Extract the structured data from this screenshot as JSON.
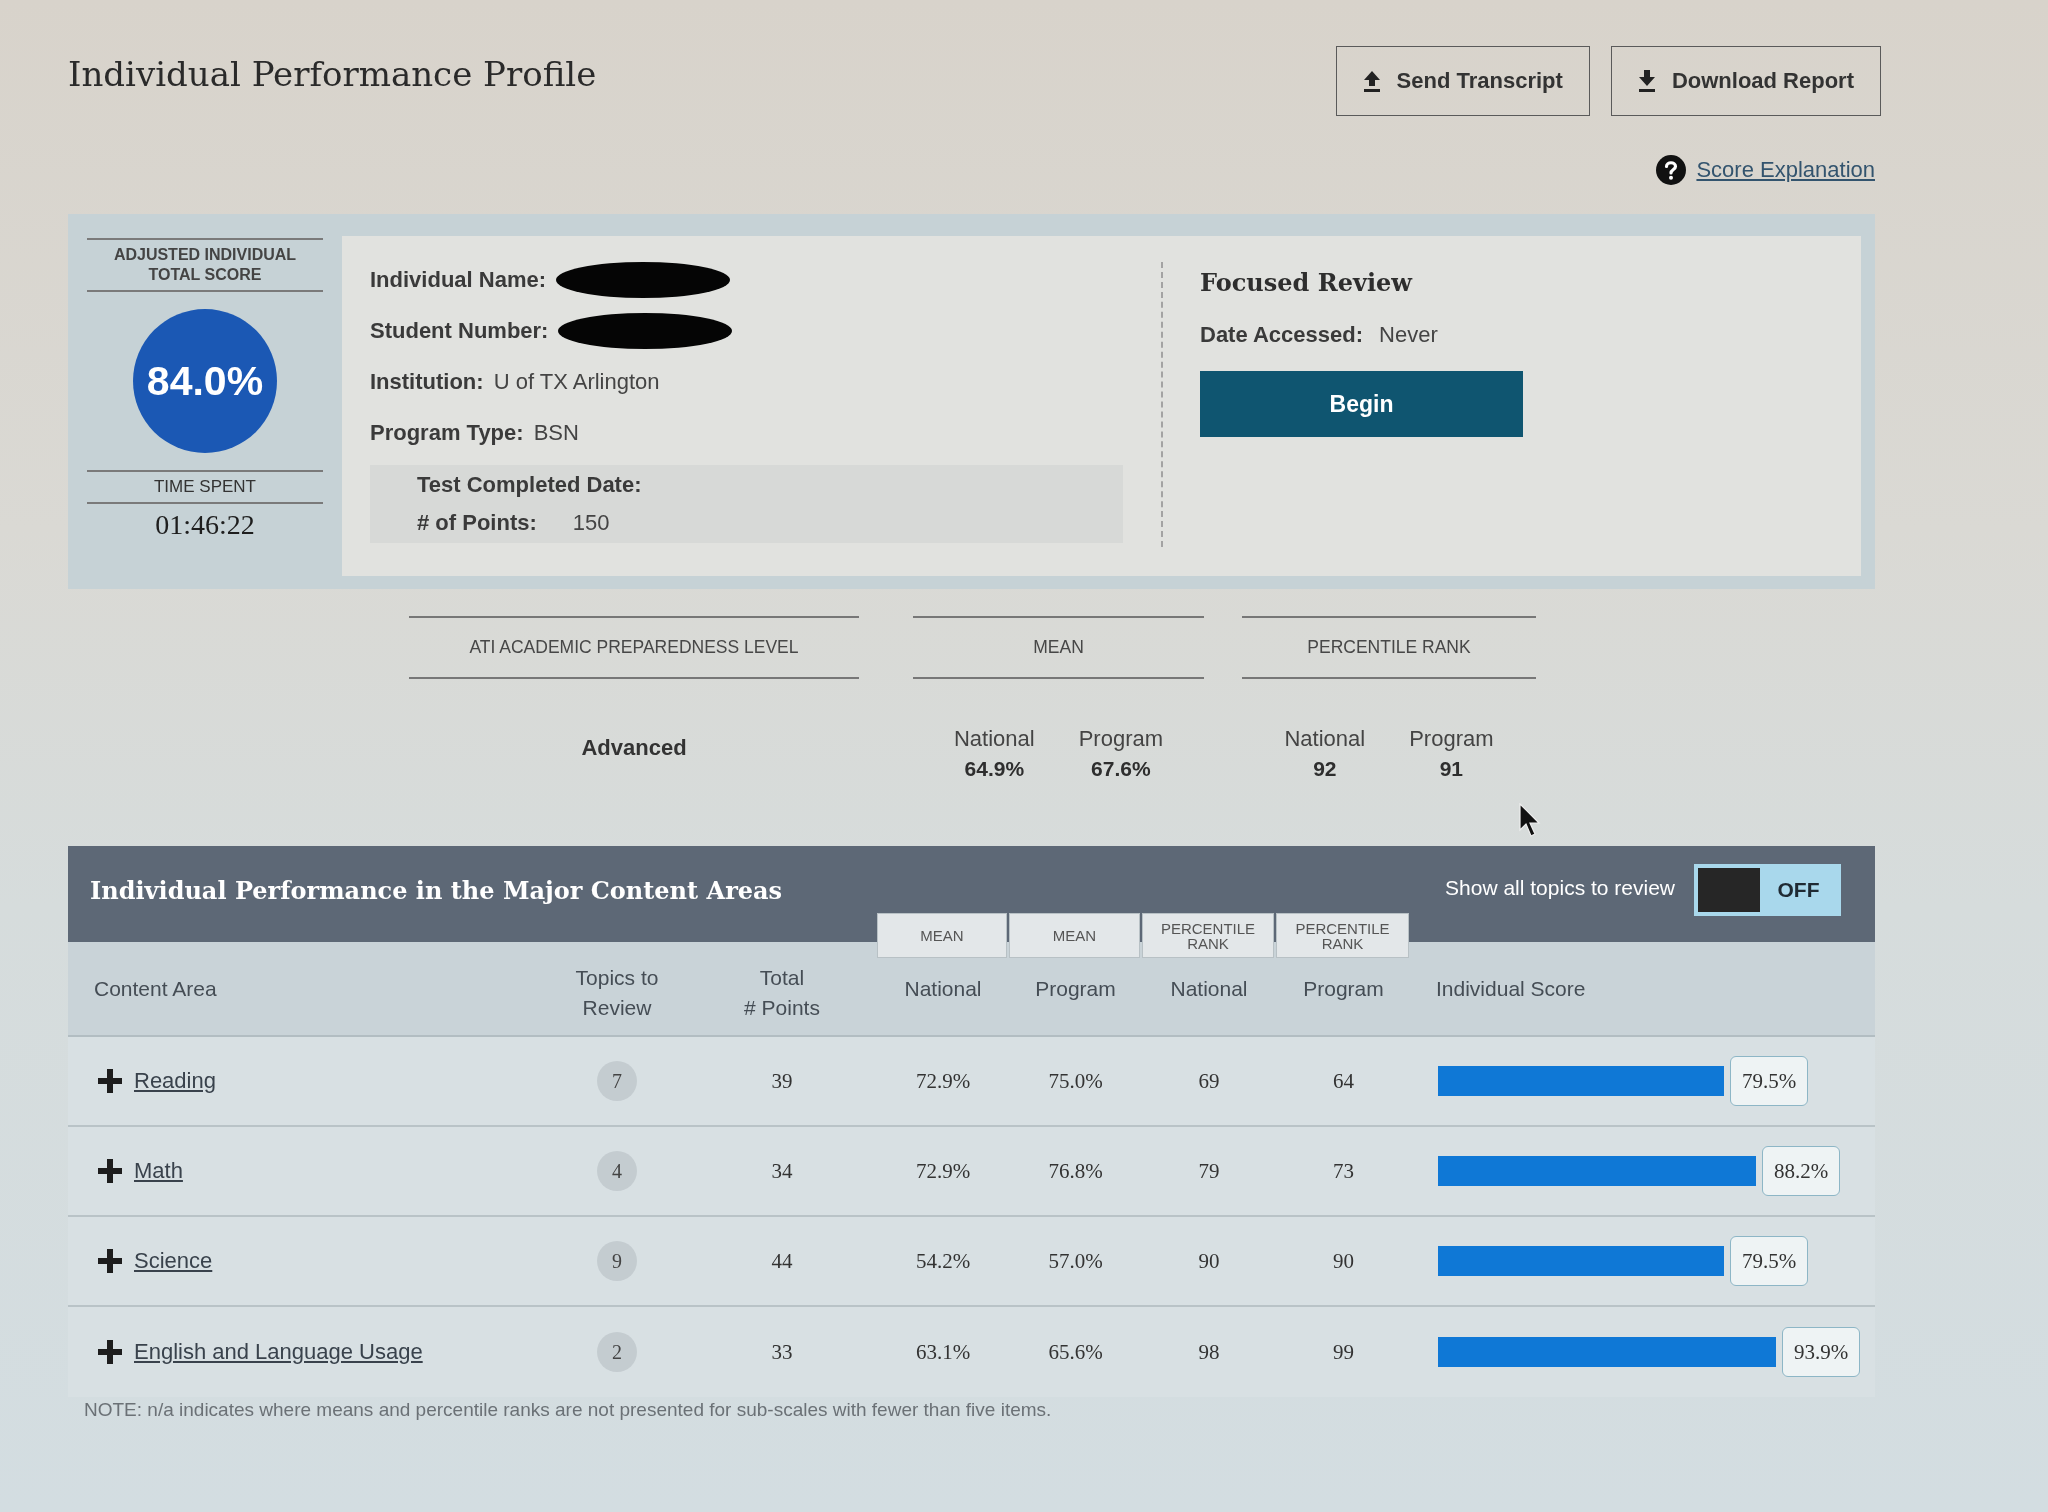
{
  "header": {
    "title": "Individual Performance Profile",
    "buttons": [
      {
        "label": "Send Transcript",
        "kind": "send"
      },
      {
        "label": "Download Report",
        "kind": "download"
      }
    ],
    "help_link": "Score Explanation"
  },
  "score_card": {
    "total_score_label": "ADJUSTED INDIVIDUAL\nTOTAL SCORE",
    "total_score": "84.0%",
    "time_spent_label": "TIME SPENT",
    "time_spent": "01:46:22",
    "fields": [
      {
        "label": "Individual Name:",
        "redacted": true
      },
      {
        "label": "Student Number:",
        "redacted": true
      },
      {
        "label": "Institution:",
        "value": "U of TX Arlington",
        "redacted": false
      },
      {
        "label": "Program Type:",
        "value": "BSN",
        "redacted": false
      }
    ],
    "test_details": [
      {
        "label": "Test Completed Date:"
      },
      {
        "label": "# of Points:",
        "value": "150"
      }
    ],
    "focused_review": {
      "title": "Focused Review",
      "date_label": "Date Accessed:",
      "date_value": "Never",
      "button": "Begin"
    }
  },
  "summary": {
    "preparedness": {
      "heading": "ATI ACADEMIC PREPAREDNESS LEVEL",
      "value": "Advanced"
    },
    "groups": [
      {
        "heading": "MEAN",
        "items": [
          {
            "label": "National",
            "value": "64.9%"
          },
          {
            "label": "Program",
            "value": "67.6%"
          }
        ]
      },
      {
        "heading": "PERCENTILE RANK",
        "items": [
          {
            "label": "National",
            "value": "92"
          },
          {
            "label": "Program",
            "value": "91"
          }
        ]
      }
    ]
  },
  "content_areas": {
    "title": "Individual Performance in the Major Content Areas",
    "toggle": {
      "label": "Show all topics to review",
      "on": false,
      "state_text": "OFF"
    },
    "column_groups": [
      "MEAN",
      "MEAN",
      "PERCENTILE\nRANK",
      "PERCENTILE\nRANK"
    ],
    "columns": [
      "Content Area",
      "Topics to\nReview",
      "Total\n# Points",
      "National",
      "Program",
      "National",
      "Program",
      "Individual Score"
    ],
    "rows": [
      {
        "name": "Reading",
        "topics": "7",
        "points": "39",
        "mean_national": "72.9%",
        "mean_program": "75.0%",
        "rank_national": "69",
        "rank_program": "64",
        "score": "79.5%",
        "level": 0.795
      },
      {
        "name": "Math",
        "topics": "4",
        "points": "34",
        "mean_national": "72.9%",
        "mean_program": "76.8%",
        "rank_national": "79",
        "rank_program": "73",
        "score": "88.2%",
        "level": 0.882
      },
      {
        "name": "Science",
        "topics": "9",
        "points": "44",
        "mean_national": "54.2%",
        "mean_program": "57.0%",
        "rank_national": "90",
        "rank_program": "90",
        "score": "79.5%",
        "level": 0.795
      },
      {
        "name": "English and Language Usage",
        "topics": "2",
        "points": "33",
        "mean_national": "63.1%",
        "mean_program": "65.6%",
        "rank_national": "98",
        "rank_program": "99",
        "score": "93.9%",
        "level": 0.939
      }
    ],
    "note": "NOTE: n/a indicates where means and percentile ranks are not presented for sub-scales with fewer than five items."
  }
}
